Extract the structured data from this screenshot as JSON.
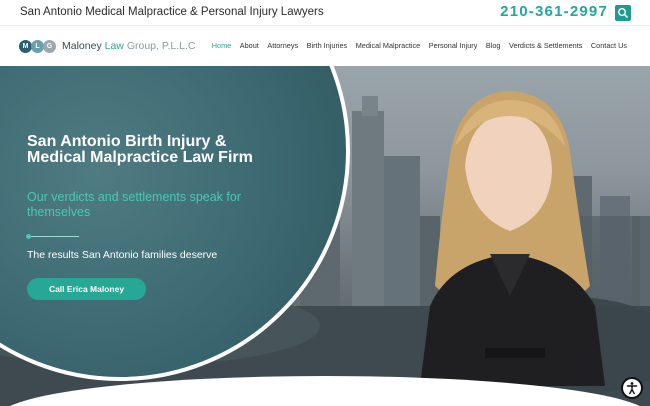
{
  "topbar": {
    "tagline": "San Antonio Medical Malpractice & Personal Injury Lawyers",
    "phone": "210-361-2997"
  },
  "logo": {
    "initials": [
      "M",
      "L",
      "G"
    ],
    "name_main": "Maloney",
    "name_law": "Law",
    "name_rest": "Group, P.L.L.C"
  },
  "nav": {
    "items": [
      {
        "label": "Home",
        "active": true
      },
      {
        "label": "About",
        "active": false
      },
      {
        "label": "Attorneys",
        "active": false
      },
      {
        "label": "Birth Injuries",
        "active": false
      },
      {
        "label": "Medical Malpractice",
        "active": false
      },
      {
        "label": "Personal Injury",
        "active": false
      },
      {
        "label": "Blog",
        "active": false
      },
      {
        "label": "Verdicts & Settlements",
        "active": false
      },
      {
        "label": "Contact Us",
        "active": false
      }
    ]
  },
  "hero": {
    "headline": "San Antonio Birth Injury & Medical Malpractice Law Firm",
    "subhead": "Our verdicts and settlements speak for themselves",
    "tagline": "The results San Antonio families deserve",
    "cta_label": "Call Erica Maloney"
  },
  "icons": {
    "search": "search-icon",
    "accessibility": "accessibility-icon"
  },
  "colors": {
    "accent": "#22a79b",
    "cta": "#27a795",
    "subhead": "#48c9b5",
    "hero_overlay": "#3e6a73"
  }
}
